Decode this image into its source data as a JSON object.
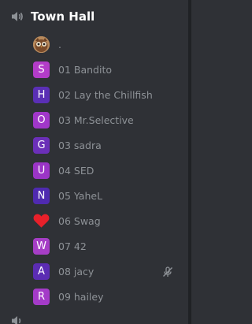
{
  "channel": {
    "name": "Town Hall",
    "icon": "speaker-icon"
  },
  "users": [
    {
      "name": ".",
      "avatar_type": "owl-image",
      "avatar_letter": "",
      "avatar_color": "#7a4b2a"
    },
    {
      "name": "01 Bandito",
      "avatar_type": "letter",
      "avatar_letter": "S",
      "avatar_color": "#b33cc8"
    },
    {
      "name": "02 Lay the Chillfish",
      "avatar_type": "letter",
      "avatar_letter": "H",
      "avatar_color": "#5a2fb5"
    },
    {
      "name": "03 Mr.Selective",
      "avatar_type": "letter",
      "avatar_letter": "O",
      "avatar_color": "#a137c9"
    },
    {
      "name": "03 sadra",
      "avatar_type": "letter",
      "avatar_letter": "G",
      "avatar_color": "#6b2fb8"
    },
    {
      "name": "04 SED",
      "avatar_type": "letter",
      "avatar_letter": "U",
      "avatar_color": "#9b35c6"
    },
    {
      "name": "05 YaheL",
      "avatar_type": "letter",
      "avatar_letter": "N",
      "avatar_color": "#4f2ab0"
    },
    {
      "name": "06 Swag",
      "avatar_type": "heart",
      "avatar_letter": "",
      "avatar_color": "#e8202a"
    },
    {
      "name": "07 42",
      "avatar_type": "letter",
      "avatar_letter": "W",
      "avatar_color": "#a63ec6"
    },
    {
      "name": "08 jacy",
      "avatar_type": "letter",
      "avatar_letter": "A",
      "avatar_color": "#5b2cb3",
      "muted": true
    },
    {
      "name": "09 hailey",
      "avatar_type": "letter",
      "avatar_letter": "R",
      "avatar_color": "#a43bc8"
    }
  ],
  "colors": {
    "background": "#2f3136",
    "username": "#8e9297",
    "channel_title": "#ffffff",
    "icon": "#8e9297"
  }
}
